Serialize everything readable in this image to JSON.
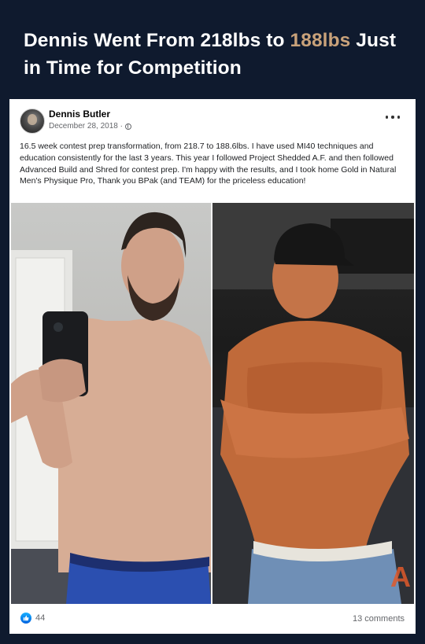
{
  "headline": {
    "before": "Dennis Went From 218lbs to ",
    "accent": "188lbs",
    "after": " Just in Time for Competition",
    "accent_color": "#c9a27a"
  },
  "post": {
    "author": "Dennis Butler",
    "date": "December 28, 2018 ·",
    "text": "16.5 week contest prep transformation, from 218.7 to 188.6lbs. I have used MI40 techniques and education consistently for the last 3 years. This year I followed Project Shedded A.F. and then followed Advanced Build and Shred for contest prep. I'm happy with the results, and I took home Gold in Natural Men's Physique Pro, Thank you BPak (and TEAM) for the priceless education!",
    "photo_after_watermark": "A",
    "likes": "44",
    "comments": "13 comments"
  },
  "icons": {
    "visibility": "globe-icon",
    "menu": "more-options-icon",
    "reaction": "like-icon"
  },
  "colors": {
    "background": "#0f1a2e",
    "like_blue": "#1877f2"
  }
}
